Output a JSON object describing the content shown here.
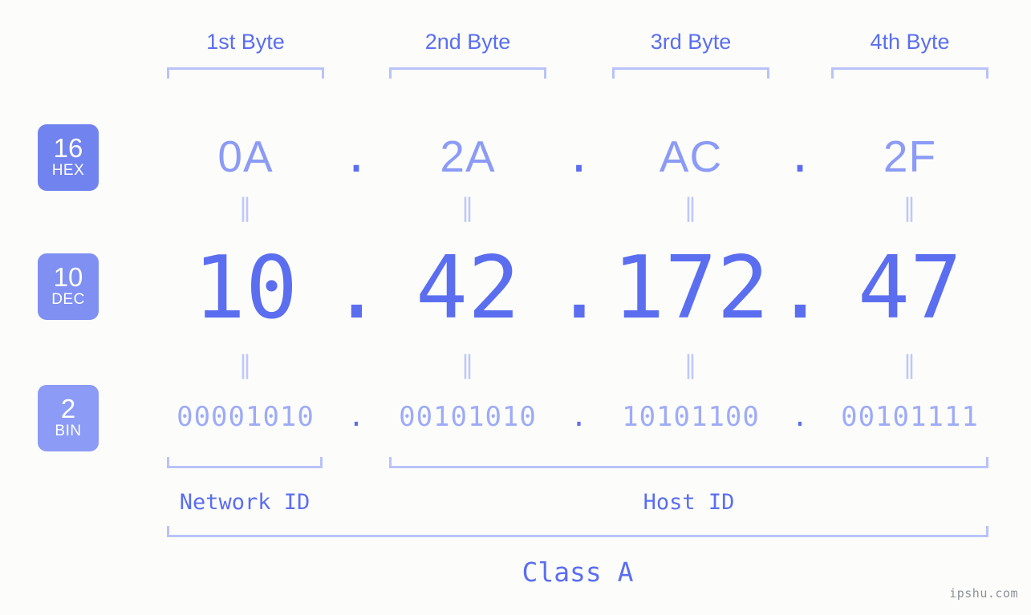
{
  "watermark": "ipshu.com",
  "byte_headers": [
    {
      "label": "1st Byte"
    },
    {
      "label": "2nd Byte"
    },
    {
      "label": "3rd Byte"
    },
    {
      "label": "4th Byte"
    }
  ],
  "bases": [
    {
      "number": "16",
      "name": "HEX",
      "color": "#7183ef"
    },
    {
      "number": "10",
      "name": "DEC",
      "color": "#7f90f2"
    },
    {
      "number": "2",
      "name": "BIN",
      "color": "#8b9bf6"
    }
  ],
  "separator": ".",
  "equals_symbol": "‖",
  "rows": {
    "hex": {
      "values": [
        "0A",
        "2A",
        "AC",
        "2F"
      ]
    },
    "dec": {
      "values": [
        "10",
        "42",
        "172",
        "47"
      ]
    },
    "bin": {
      "values": [
        "00001010",
        "00101010",
        "10101100",
        "00101111"
      ]
    }
  },
  "ip_address": "10.42.172.47",
  "segments": [
    {
      "label": "Network ID"
    },
    {
      "label": "Host ID"
    }
  ],
  "class_label": "Class A",
  "colors": {
    "background": "#fcfdfa",
    "accent": "#5b6ef0",
    "accent_mid": "#8b9bf6",
    "accent_light": "#b9c2fb",
    "badge": "#7183ef",
    "watermark": "#8c9099"
  }
}
